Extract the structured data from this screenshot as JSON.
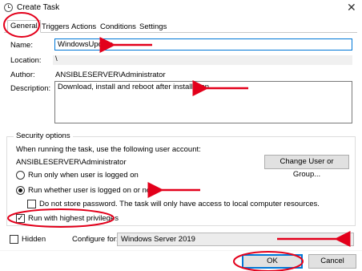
{
  "window": {
    "title": "Create Task",
    "close_glyph": "✕"
  },
  "tabs": [
    {
      "label": "General"
    },
    {
      "label": "Triggers"
    },
    {
      "label": "Actions"
    },
    {
      "label": "Conditions"
    },
    {
      "label": "Settings"
    }
  ],
  "general": {
    "name_label": "Name:",
    "name_value": "WindowsUpdate",
    "location_label": "Location:",
    "location_value": "\\",
    "author_label": "Author:",
    "author_value": "ANSIBLESERVER\\Administrator",
    "description_label": "Description:",
    "description_value": "Download, install and reboot after installation"
  },
  "security": {
    "group_title": "Security options",
    "account_prompt": "When running the task, use the following user account:",
    "account_value": "ANSIBLESERVER\\Administrator",
    "change_button": "Change User or Group...",
    "radio_logged_on": "Run only when user is logged on",
    "radio_whether": "Run whether user is logged on or not",
    "radio_selected": "whether",
    "no_store_password": "Do not store password.  The task will only have access to local computer resources.",
    "highest_privileges": "Run with highest privileges",
    "highest_privileges_checked": true
  },
  "footer": {
    "hidden_label": "Hidden",
    "configure_label": "Configure for:",
    "configure_value": "Windows Server 2019",
    "ok_label": "OK",
    "cancel_label": "Cancel"
  },
  "annotation_color": "#e3001b",
  "icons": [
    "task-scheduler-icon",
    "close-icon",
    "chevron-down-icon",
    "check-icon",
    "arrow-annotation-icon"
  ]
}
